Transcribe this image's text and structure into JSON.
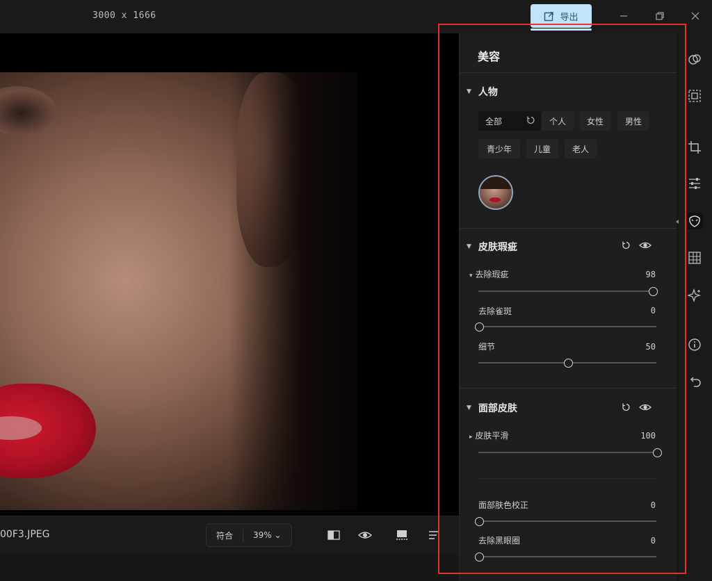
{
  "titlebar": {
    "dimensions": "3000 x 1666",
    "export_label": "导出",
    "export_icon": "export-icon",
    "minimize_icon": "minimize-icon",
    "restore_icon": "restore-icon",
    "close_icon": "close-icon"
  },
  "bottombar": {
    "filename": "00F3.JPEG",
    "fit_label": "符合",
    "zoom_label": "39% ⌄",
    "icons": [
      "compare-icon",
      "eye-icon",
      "filmstrip-icon",
      "list-icon"
    ]
  },
  "panel": {
    "title": "美容",
    "people": {
      "header": "人物",
      "chips": [
        "全部",
        "个人",
        "女性",
        "男性",
        "青少年",
        "儿童",
        "老人"
      ],
      "reset_icon": "reset-icon"
    },
    "skin_blemish": {
      "header": "皮肤瑕疵",
      "sliders": [
        {
          "label": "去除瑕疵",
          "value": "98",
          "fraction": 0.98
        },
        {
          "label": "去除雀斑",
          "value": "0",
          "fraction": 0
        },
        {
          "label": "细节",
          "value": "50",
          "fraction": 0.5
        }
      ]
    },
    "face_skin": {
      "header": "面部皮肤",
      "sliders": [
        {
          "label": "皮肤平滑",
          "value": "100",
          "fraction": 1.0
        },
        {
          "label": "面部肤色校正",
          "value": "0",
          "fraction": 0
        },
        {
          "label": "去除黑眼圈",
          "value": "0",
          "fraction": 0
        }
      ]
    }
  },
  "rail_icons": [
    "overlay-icon",
    "select-icon",
    "crop-icon",
    "adjust-icon",
    "beauty-icon",
    "grid-icon",
    "sparkle-icon",
    "info-icon",
    "undo-icon"
  ],
  "colors": {
    "accent": "#bfe3f7",
    "highlight_border": "#e5322d",
    "lips": "#c8142d"
  }
}
